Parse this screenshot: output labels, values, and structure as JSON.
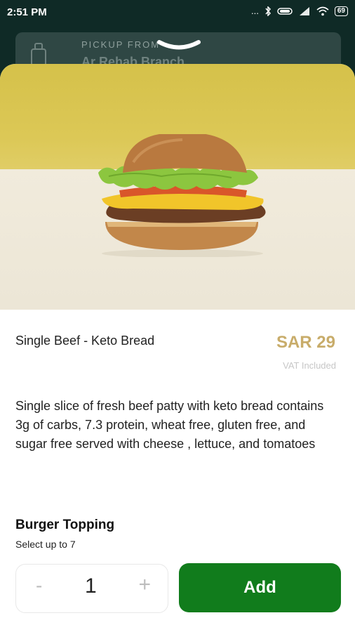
{
  "status_bar": {
    "time": "2:51 PM",
    "signal_glyphs": "...",
    "battery": "69"
  },
  "pickup": {
    "label": "PICKUP FROM",
    "branch": "Ar Rehab Branch"
  },
  "product": {
    "name": "Single Beef - Keto Bread",
    "price": "SAR 29",
    "vat_note": "VAT Included",
    "description": "Single slice of fresh beef patty with keto bread contains 3g of carbs, 7.3 protein, wheat free, gluten free, and sugar free served with cheese , lettuce, and tomatoes"
  },
  "topping": {
    "title": "Burger Topping",
    "subtitle": "Select up to 7"
  },
  "stepper": {
    "minus": "-",
    "quantity": "1",
    "plus": "+"
  },
  "actions": {
    "add_label": "Add"
  },
  "colors": {
    "accent_green": "#117c1c",
    "price_gold": "#c8ac6a",
    "header_dark": "#0f2a26"
  }
}
